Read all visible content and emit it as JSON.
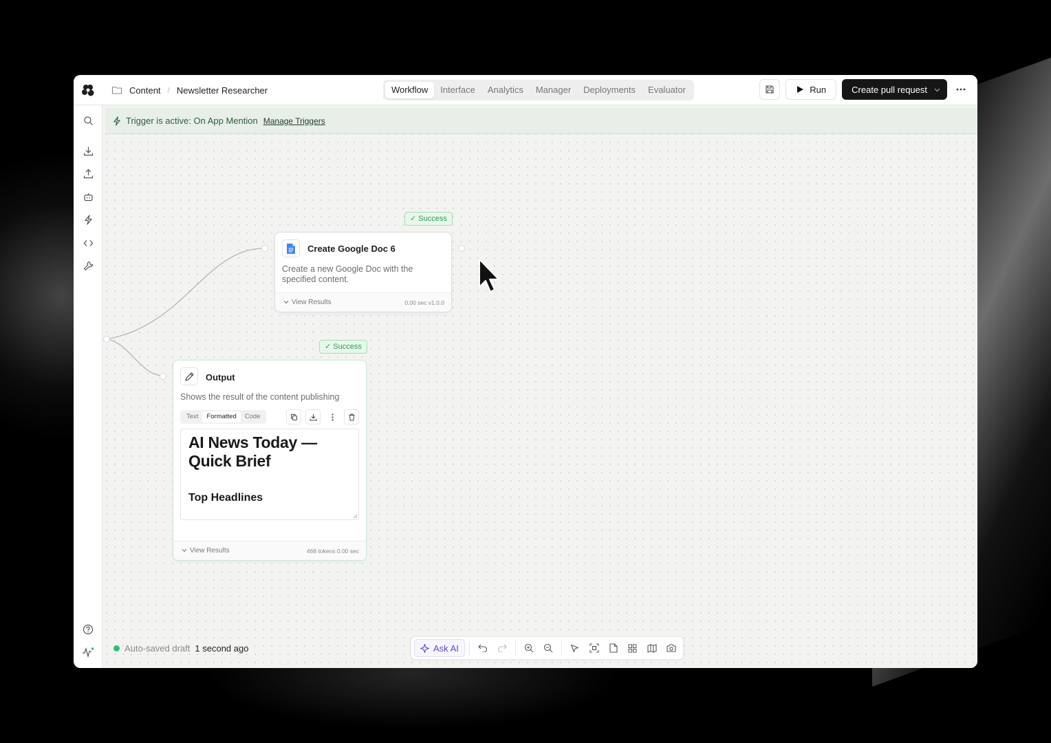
{
  "breadcrumb": {
    "folder": "Content",
    "page": "Newsletter Researcher"
  },
  "tabs": [
    {
      "label": "Workflow",
      "active": true
    },
    {
      "label": "Interface",
      "active": false
    },
    {
      "label": "Analytics",
      "active": false
    },
    {
      "label": "Manager",
      "active": false
    },
    {
      "label": "Deployments",
      "active": false
    },
    {
      "label": "Evaluator",
      "active": false
    }
  ],
  "actions": {
    "run_label": "Run",
    "pr_label": "Create pull request"
  },
  "trigger": {
    "text": "Trigger is active: On App Mention",
    "manage_label": "Manage Triggers"
  },
  "nodes": {
    "google_doc": {
      "status": "✓ Success",
      "title": "Create Google Doc 6",
      "description": "Create a new Google Doc with the specified content.",
      "view_results": "View Results",
      "meta": "0.00 sec   v1.0.0"
    },
    "output": {
      "status": "✓ Success",
      "title": "Output",
      "description": "Shows the result of the content publishing",
      "view_tabs": [
        "Text",
        "Formatted",
        "Code"
      ],
      "active_view": "Formatted",
      "preview_title": "AI News Today — Quick Brief",
      "preview_heading": "Top Headlines",
      "view_results": "View Results",
      "meta": "468 tokens   0.00 sec"
    }
  },
  "status_bar": {
    "text": "Auto-saved draft",
    "time": "1 second ago"
  },
  "toolbar": {
    "ask_ai_label": "Ask AI"
  },
  "colors": {
    "success": "#2f9c52",
    "trigger_bg": "#e7efe8",
    "primary_dark": "#161616",
    "ai_accent": "#5b46c9"
  }
}
